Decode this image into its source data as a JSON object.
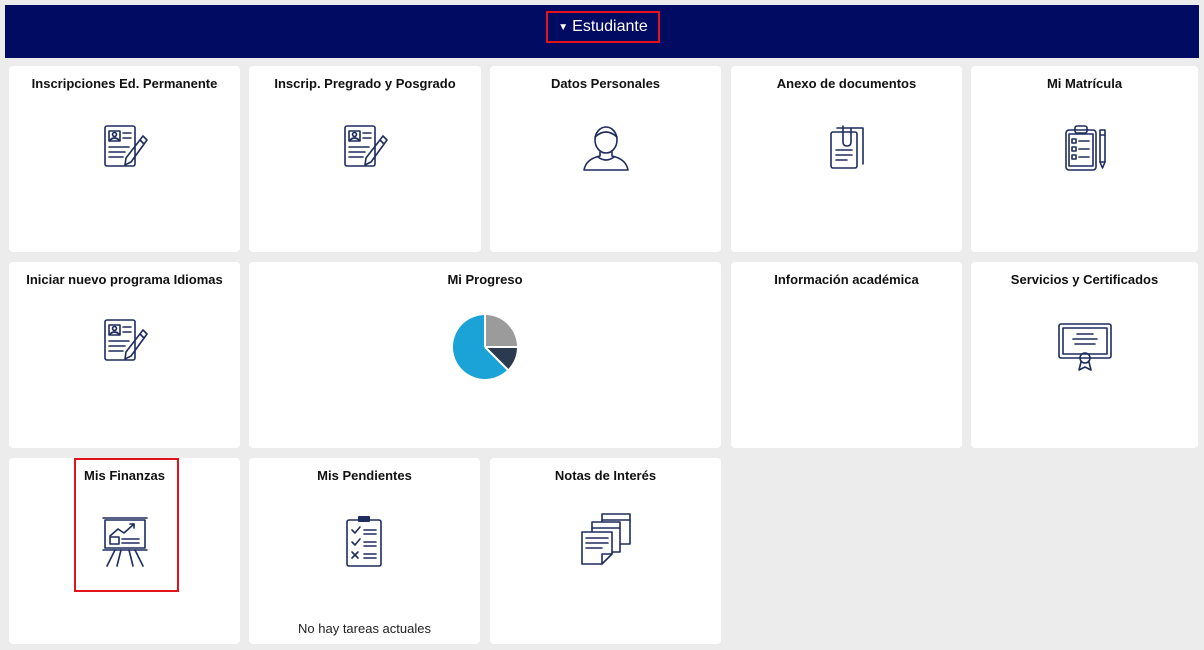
{
  "header": {
    "toggle_label": "Estudiante"
  },
  "tiles": {
    "inscripciones_ed": {
      "title": "Inscripciones Ed. Permanente"
    },
    "inscrip_pregrado": {
      "title": "Inscrip. Pregrado y Posgrado"
    },
    "datos_personales": {
      "title": "Datos Personales"
    },
    "anexo_documentos": {
      "title": "Anexo de documentos"
    },
    "mi_matricula": {
      "title": "Mi Matrícula"
    },
    "iniciar_idiomas": {
      "title": "Iniciar nuevo programa Idiomas"
    },
    "mi_progreso": {
      "title": "Mi Progreso"
    },
    "info_academica": {
      "title": "Información académica"
    },
    "servicios_certificados": {
      "title": "Servicios y Certificados"
    },
    "mis_finanzas": {
      "title": "Mis Finanzas"
    },
    "mis_pendientes": {
      "title": "Mis Pendientes",
      "footer": "No hay tareas actuales"
    },
    "notas_interes": {
      "title": "Notas de Interés"
    }
  },
  "colors": {
    "header_bg": "#020b62",
    "highlight": "#e3131c",
    "pie_blue": "#1ba3d8",
    "pie_gray": "#9b9b9b",
    "pie_dark": "#2c3a4f",
    "icon_stroke": "#1e2c5e"
  }
}
